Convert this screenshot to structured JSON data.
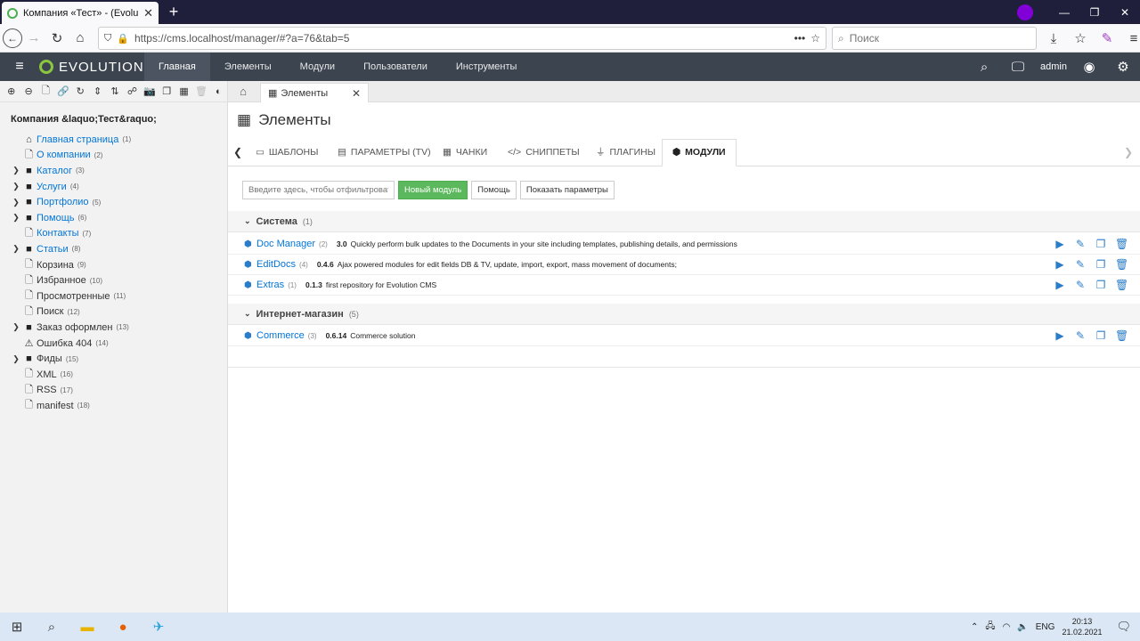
{
  "browser": {
    "tab_title": "Компания «Тест» - (Evolution",
    "url": "https://cms.localhost/manager/#?a=76&tab=5",
    "search_placeholder": "Поиск"
  },
  "header": {
    "logo": "EVOLUTION",
    "menu": [
      "Главная",
      "Элементы",
      "Модули",
      "Пользователи",
      "Инструменты"
    ],
    "user": "admin"
  },
  "sidebar": {
    "site_name": "Компания &laquo;Тест&raquo;",
    "items": [
      {
        "label": "Главная страница",
        "count": "(1)",
        "icon": "home-icon",
        "arrow": false,
        "published": true
      },
      {
        "label": "О компании",
        "count": "(2)",
        "icon": "page-icon",
        "arrow": false,
        "published": true
      },
      {
        "label": "Каталог",
        "count": "(3)",
        "icon": "folder-icon",
        "arrow": true,
        "published": true
      },
      {
        "label": "Услуги",
        "count": "(4)",
        "icon": "folder-icon",
        "arrow": true,
        "published": true
      },
      {
        "label": "Портфолио",
        "count": "(5)",
        "icon": "folder-icon",
        "arrow": true,
        "published": true
      },
      {
        "label": "Помощь",
        "count": "(6)",
        "icon": "folder-icon",
        "arrow": true,
        "published": true
      },
      {
        "label": "Контакты",
        "count": "(7)",
        "icon": "page-icon",
        "arrow": false,
        "published": true
      },
      {
        "label": "Статьи",
        "count": "(8)",
        "icon": "folder-icon",
        "arrow": true,
        "published": true
      },
      {
        "label": "Корзина",
        "count": "(9)",
        "icon": "page-icon",
        "arrow": false,
        "published": false
      },
      {
        "label": "Избранное",
        "count": "(10)",
        "icon": "page-icon",
        "arrow": false,
        "published": false
      },
      {
        "label": "Просмотренные",
        "count": "(11)",
        "icon": "page-icon",
        "arrow": false,
        "published": false
      },
      {
        "label": "Поиск",
        "count": "(12)",
        "icon": "page-icon",
        "arrow": false,
        "published": false
      },
      {
        "label": "Заказ оформлен",
        "count": "(13)",
        "icon": "folder-icon",
        "arrow": true,
        "published": false
      },
      {
        "label": "Ошибка 404",
        "count": "(14)",
        "icon": "warning-icon",
        "arrow": false,
        "published": false
      },
      {
        "label": "Фиды",
        "count": "(15)",
        "icon": "folder-icon",
        "arrow": true,
        "published": false
      },
      {
        "label": "XML",
        "count": "(16)",
        "icon": "page-icon",
        "arrow": false,
        "published": false
      },
      {
        "label": "RSS",
        "count": "(17)",
        "icon": "page-icon",
        "arrow": false,
        "published": false
      },
      {
        "label": "manifest",
        "count": "(18)",
        "icon": "page-icon",
        "arrow": false,
        "published": false
      }
    ]
  },
  "content": {
    "tab_label": "Элементы",
    "page_title": "Элементы",
    "subtabs": [
      "ШАБЛОНЫ",
      "ПАРАМЕТРЫ (TV)",
      "ЧАНКИ",
      "СНИППЕТЫ",
      "ПЛАГИНЫ",
      "МОДУЛИ"
    ],
    "filter_placeholder": "Введите здесь, чтобы отфильтровать",
    "buttons": {
      "new": "Новый модуль",
      "help": "Помощь",
      "show_params": "Показать параметры"
    },
    "categories": [
      {
        "name": "Система",
        "count": "(1)",
        "modules": [
          {
            "name": "Doc Manager",
            "id": "(2)",
            "version": "3.0",
            "desc": "Quickly perform bulk updates to the Documents in your site including templates, publishing details, and permissions"
          },
          {
            "name": "EditDocs",
            "id": "(4)",
            "version": "0.4.6",
            "desc": "Ajax powered modules for edit fields DB & TV, update, import, export, mass movement of documents;"
          },
          {
            "name": "Extras",
            "id": "(1)",
            "version": "0.1.3",
            "desc": "first repository for Evolution CMS"
          }
        ]
      },
      {
        "name": "Интернет-магазин",
        "count": "(5)",
        "modules": [
          {
            "name": "Commerce",
            "id": "(3)",
            "version": "0.6.14",
            "desc": "Commerce solution"
          }
        ]
      }
    ]
  },
  "taskbar": {
    "lang": "ENG",
    "time": "20:13",
    "date": "21.02.2021"
  }
}
